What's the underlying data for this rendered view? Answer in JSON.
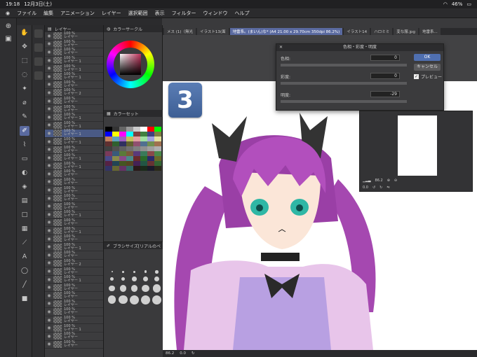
{
  "status": {
    "time": "19:18",
    "date": "12月3日(土)",
    "battery": "46%"
  },
  "menu": [
    "ファイル",
    "編集",
    "アニメーション",
    "レイヤー",
    "選択範囲",
    "表示",
    "フィルター",
    "ウィンドウ",
    "ヘルプ"
  ],
  "panels": {
    "layer": "レイヤー",
    "color_circle": "カラーサークル",
    "color_set": "カラーセット",
    "brush_size": "ブラシサイズ[リアルのペ"
  },
  "layers": [
    {
      "opacity": "100 %",
      "name": "レイヤー"
    },
    {
      "opacity": "100 %",
      "name": "レイヤー"
    },
    {
      "opacity": "100 %",
      "name": "レイヤー"
    },
    {
      "opacity": "100 %",
      "name": "レイヤー 1"
    },
    {
      "opacity": "100 %",
      "name": "レイヤー 1"
    },
    {
      "opacity": "100 %",
      "name": "レイヤー 1"
    },
    {
      "opacity": "100 %",
      "name": "レイヤー"
    },
    {
      "opacity": "100 %",
      "name": "レイヤー 2"
    },
    {
      "opacity": "100 %",
      "name": "レイヤー"
    },
    {
      "opacity": "100 %",
      "name": "レイヤー"
    },
    {
      "opacity": "100 %",
      "name": "レイヤー 1"
    },
    {
      "opacity": "100 %",
      "name": "レイヤー 1"
    },
    {
      "opacity": "100 %",
      "name": "レイヤー 1"
    },
    {
      "opacity": "100 %",
      "name": "レイヤー 1"
    },
    {
      "opacity": "100 %",
      "name": "レイヤー"
    },
    {
      "opacity": "100 %",
      "name": "レイヤー 1"
    },
    {
      "opacity": "100 %",
      "name": "レイヤー 1"
    },
    {
      "opacity": "100 %",
      "name": "レイヤー"
    },
    {
      "opacity": "100 %",
      "name": "レイヤー"
    },
    {
      "opacity": "100 %",
      "name": "レイヤー"
    },
    {
      "opacity": "100 %",
      "name": "レイヤー"
    },
    {
      "opacity": "100 %",
      "name": "レイヤー"
    },
    {
      "opacity": "100 %",
      "name": "レイヤー 1"
    },
    {
      "opacity": "100 %",
      "name": "レイヤー"
    },
    {
      "opacity": "100 %",
      "name": "レイヤー 1"
    },
    {
      "opacity": "100 %",
      "name": "レイヤー"
    },
    {
      "opacity": "100 %",
      "name": "レイヤー 1"
    },
    {
      "opacity": "100 %",
      "name": "レイヤー"
    },
    {
      "opacity": "100 %",
      "name": "レイヤー 2"
    },
    {
      "opacity": "100 %",
      "name": "レイヤー"
    },
    {
      "opacity": "100 %",
      "name": "レイヤー 1"
    },
    {
      "opacity": "100 %",
      "name": "レイヤー"
    },
    {
      "opacity": "100 %",
      "name": "レイヤー"
    },
    {
      "opacity": "100 %",
      "name": "レイヤー"
    },
    {
      "opacity": "100 %",
      "name": "レイヤー"
    },
    {
      "opacity": "100 %",
      "name": "レイヤー"
    },
    {
      "opacity": "100 %",
      "name": "レイヤー 1"
    },
    {
      "opacity": "100 %",
      "name": "レイヤー"
    },
    {
      "opacity": "100 %",
      "name": "レイヤー"
    }
  ],
  "tabs": [
    {
      "label": "メス (1)（無光"
    },
    {
      "label": "イラスト13(面"
    },
    {
      "label": "地雷系。(まいん)な* (A4 21.00 x 29.70cm 350dpi 86.2%)",
      "active": true
    },
    {
      "label": "イラスト14"
    },
    {
      "label": "ハロミミ"
    },
    {
      "label": "変な服.jpg"
    },
    {
      "label": "地雷系..."
    }
  ],
  "badge_number": "3",
  "dialog": {
    "title": "色相・彩度・明度",
    "hue_label": "色相:",
    "hue_value": "0",
    "sat_label": "彩度:",
    "sat_value": "0",
    "lum_label": "明度:",
    "lum_value": "-29",
    "ok": "OK",
    "cancel": "キャンセル",
    "preview": "プレビュー"
  },
  "navigator": {
    "zoom": "86.2",
    "angle": "0.0"
  },
  "bottom": {
    "zoom": "86.2",
    "angle": "0.0"
  },
  "colors": {
    "accent": "#5a6aa0",
    "swatches": [
      "#000000",
      "#333333",
      "#666666",
      "#999999",
      "#cccccc",
      "#ffffff",
      "#ff0000",
      "#00ff00",
      "#0000ff",
      "#ffff00",
      "#ff00ff",
      "#00ffff",
      "#804040",
      "#408040",
      "#404080",
      "#808040",
      "#c08060",
      "#60a0c0",
      "#a060c0",
      "#c0c060",
      "#e0a0a0",
      "#a0e0a0",
      "#a0a0e0",
      "#e0e0a0",
      "#603030",
      "#306030",
      "#303060",
      "#606030",
      "#905070",
      "#507090",
      "#709050",
      "#a07050",
      "#404040",
      "#505050",
      "#606060",
      "#707070",
      "#808080",
      "#909090",
      "#a0a0a0",
      "#b0b0b0",
      "#7a3a5a",
      "#3a5a7a",
      "#5a7a3a",
      "#7a5a3a",
      "#5a3a7a",
      "#3a7a5a",
      "#8a4a4a",
      "#4a8a4a",
      "#4a4a8a",
      "#8a8a4a",
      "#8a4a8a",
      "#4a8a8a",
      "#6a2a2a",
      "#2a6a2a",
      "#2a2a6a",
      "#6a6a2a",
      "#552244",
      "#224455",
      "#445522",
      "#554422",
      "#442255",
      "#225544",
      "#663333",
      "#336633",
      "#333366",
      "#666633",
      "#663366",
      "#336666",
      "#2a1a1a",
      "#1a2a1a",
      "#1a1a2a",
      "#2a2a1a"
    ]
  },
  "brush_sizes": [
    "0.7",
    "1",
    "1.5",
    "2",
    "2.5",
    "3",
    "4",
    "5",
    "6",
    "7",
    "8",
    "10",
    "12",
    "15",
    "17",
    "20",
    "25",
    "30",
    "40",
    "50"
  ]
}
